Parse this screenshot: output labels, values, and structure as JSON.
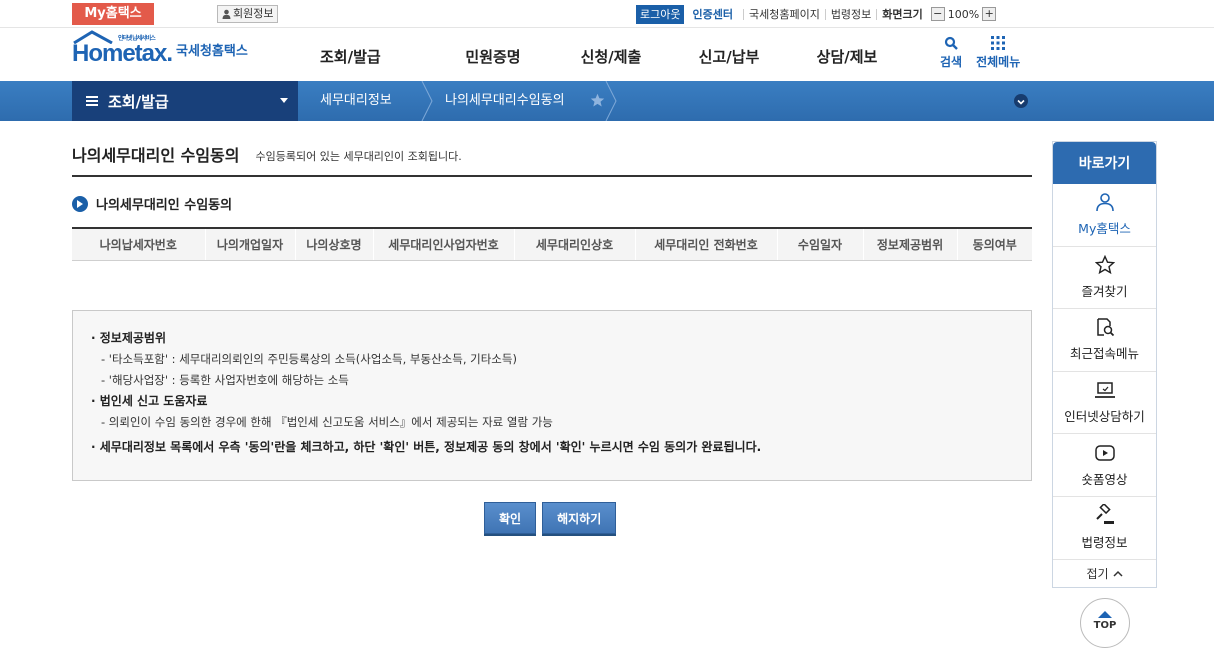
{
  "topbar": {
    "myhome": "My홈택스",
    "member_info": "회원정보",
    "logout": "로그아웃",
    "cert_center": "인증센터",
    "links": [
      "국세청홈페이지",
      "법령정보",
      "화면크기"
    ],
    "zoom_minus": "−",
    "zoom_value": "100%",
    "zoom_plus": "+"
  },
  "header": {
    "logo_text": "Hometax.",
    "logo_sub": "인터넷 납세서비스",
    "logo_kr": "국세청홈택스",
    "gnb": [
      "조회/발급",
      "민원증명",
      "신청/제출",
      "신고/납부",
      "상담/제보"
    ],
    "search": "검색",
    "all_menu": "전체메뉴"
  },
  "location": {
    "main": "조회/발급",
    "seg1": "세무대리정보",
    "seg2": "나의세무대리수임동의"
  },
  "page": {
    "title": "나의세무대리인 수임동의",
    "desc": "수임등록되어 있는 세무대리인이 조회됩니다.",
    "section_title": "나의세무대리인 수임동의",
    "columns": [
      "나의납세자번호",
      "나의개업일자",
      "나의상호명",
      "세무대리인사업자번호",
      "세무대리인상호",
      "세무대리인 전화번호",
      "수임일자",
      "정보제공범위",
      "동의여부"
    ]
  },
  "info": {
    "h1": "정보제공범위",
    "l1": "- '타소득포함' : 세무대리의뢰인의 주민등록상의 소득(사업소득, 부동산소득, 기타소득)",
    "l2": "- '해당사업장' : 등록한 사업자번호에 해당하는 소득",
    "h2": "법인세 신고 도움자료",
    "l3": "- 의뢰인이 수임 동의한 경우에 한해 『법인세 신고도움 서비스』에서 제공되는 자료 열람 가능",
    "h3": "세무대리정보 목록에서 우측 '동의'란을 체크하고, 하단 '확인' 버튼, 정보제공 동의 창에서 '확인' 누르시면 수임 동의가 완료됩니다."
  },
  "buttons": {
    "confirm": "확인",
    "cancel": "해지하기"
  },
  "quick": {
    "title": "바로가기",
    "items": [
      "My홈택스",
      "즐겨찾기",
      "최근접속메뉴",
      "인터넷상담하기",
      "숏폼영상",
      "법령정보"
    ],
    "fold": "접기",
    "top": "TOP"
  }
}
